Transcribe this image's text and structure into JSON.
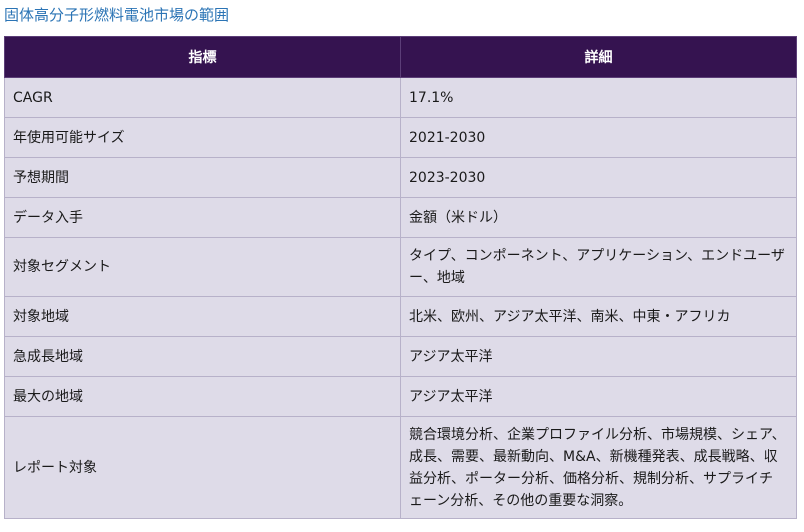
{
  "title": "固体高分子形燃料電池市場の範囲",
  "table": {
    "headers": [
      "指標",
      "詳細"
    ],
    "rows": [
      {
        "label": "CAGR",
        "value": "17.1%"
      },
      {
        "label": "年使用可能サイズ",
        "value": "2021-2030"
      },
      {
        "label": "予想期間",
        "value": "2023-2030"
      },
      {
        "label": "データ入手",
        "value": "金額（米ドル）"
      },
      {
        "label": "対象セグメント",
        "value": "タイプ、コンポーネント、アプリケーション、エンドユーザー、地域"
      },
      {
        "label": "対象地域",
        "value": "北米、欧州、アジア太平洋、南米、中東・アフリカ"
      },
      {
        "label": "急成長地域",
        "value": "アジア太平洋"
      },
      {
        "label": "最大の地域",
        "value": "アジア太平洋"
      },
      {
        "label": "レポート対象",
        "value": "競合環境分析、企業プロファイル分析、市場規模、シェア、成長、需要、最新動向、M&A、新機種発表、成長戦略、収益分析、ポーター分析、価格分析、規制分析、サプライチェーン分析、その他の重要な洞察。"
      }
    ]
  }
}
